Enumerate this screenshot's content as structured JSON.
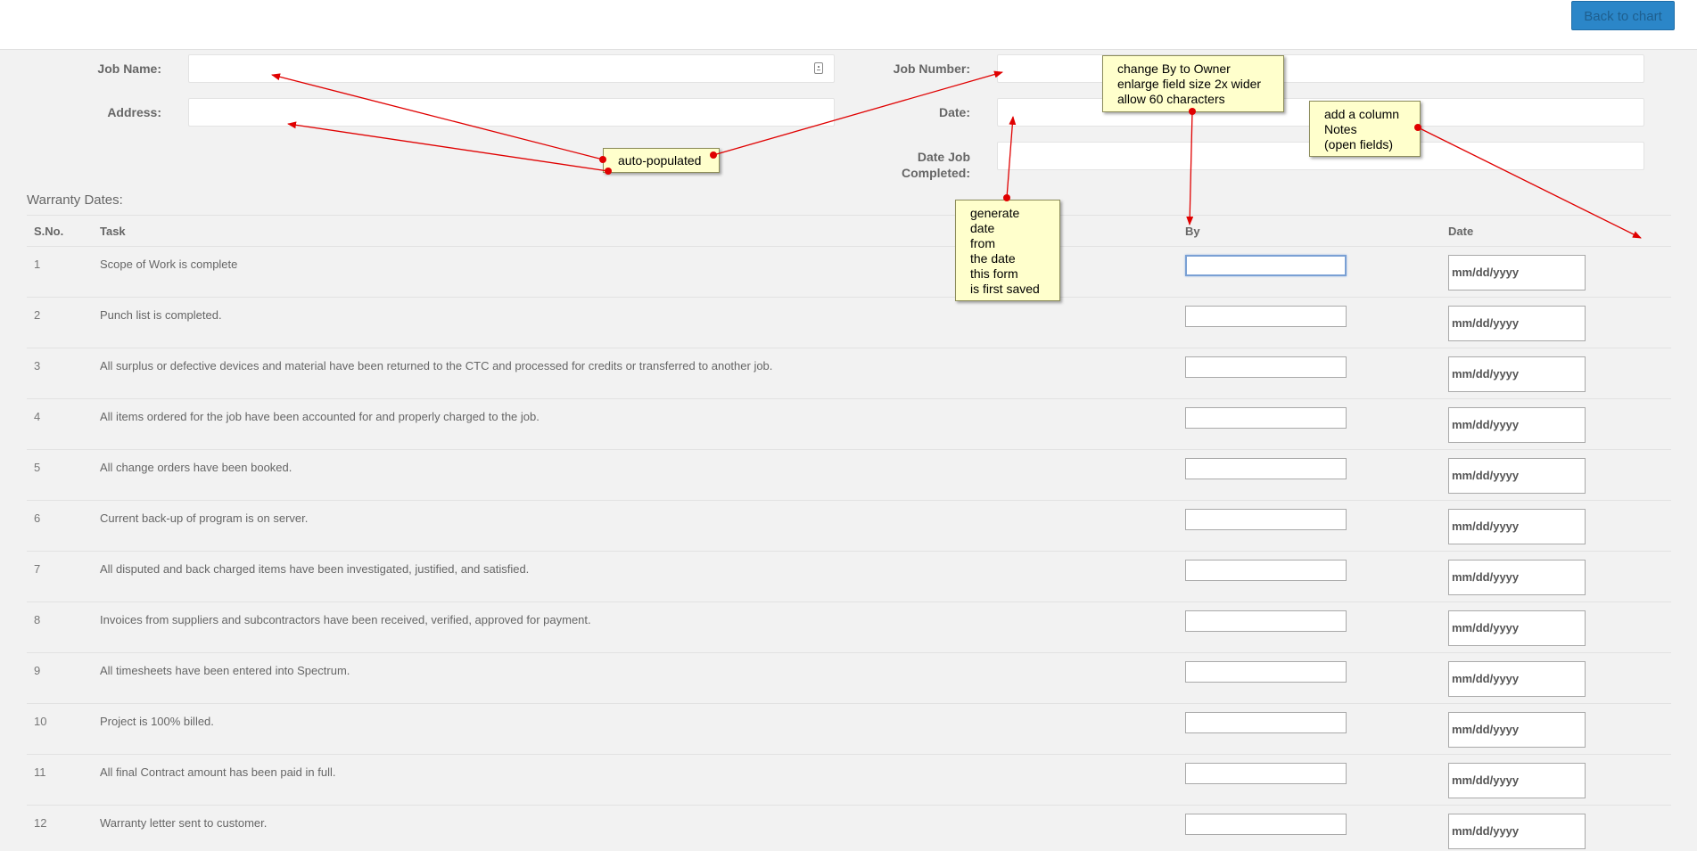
{
  "toolbar": {
    "back_label": "Back to chart"
  },
  "form": {
    "job_name_label": "Job Name:",
    "address_label": "Address:",
    "job_number_label": "Job Number:",
    "date_label": "Date:",
    "date_job_completed_label_line1": "Date Job",
    "date_job_completed_label_line2": "Completed:"
  },
  "warranty": {
    "title": "Warranty Dates:",
    "columns": {
      "sno": "S.No.",
      "task": "Task",
      "by": "By",
      "date": "Date"
    },
    "date_placeholder": "mm/dd/yyyy",
    "rows": [
      {
        "no": "1",
        "task": "Scope of Work is complete"
      },
      {
        "no": "2",
        "task": "Punch list is completed."
      },
      {
        "no": "3",
        "task": "All surplus or defective devices and material have been returned to the CTC and processed for credits or transferred to another job."
      },
      {
        "no": "4",
        "task": "All items ordered for the job have been accounted for and properly charged to the job."
      },
      {
        "no": "5",
        "task": "All change orders have been booked."
      },
      {
        "no": "6",
        "task": "Current back-up of program is on server."
      },
      {
        "no": "7",
        "task": "All disputed and back charged items have been investigated, justified, and satisfied."
      },
      {
        "no": "8",
        "task": "Invoices from suppliers and subcontractors have been received, verified, approved for payment."
      },
      {
        "no": "9",
        "task": "All timesheets have been entered into Spectrum."
      },
      {
        "no": "10",
        "task": "Project is 100% billed."
      },
      {
        "no": "11",
        "task": "All final Contract amount has been paid in full."
      },
      {
        "no": "12",
        "task": "Warranty letter sent to customer."
      }
    ]
  },
  "annotations": {
    "auto_populated": "auto-populated",
    "change_by": [
      "change By to Owner",
      "enlarge field size 2x wider",
      "allow 60 characters"
    ],
    "add_column": [
      "add a column",
      "Notes",
      "(open fields)"
    ],
    "generate_date": [
      "generate",
      "date",
      "from",
      "the date",
      "this form",
      "is first saved"
    ]
  },
  "colors": {
    "accent": "#2b86c8",
    "note_bg": "#ffffcc",
    "arrow": "#e00000"
  }
}
